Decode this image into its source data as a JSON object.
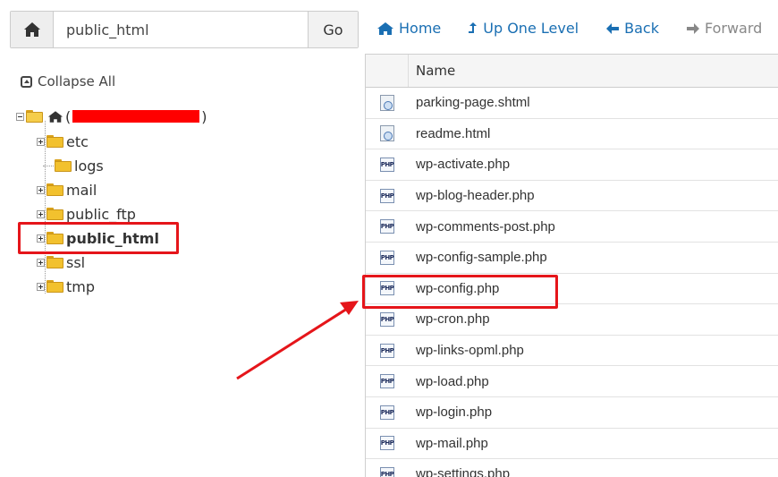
{
  "pathbar": {
    "path_value": "public_html",
    "go_label": "Go",
    "home_icon": "home-icon"
  },
  "nav": {
    "home": "Home",
    "up": "Up One Level",
    "back": "Back",
    "forward": "Forward"
  },
  "tree": {
    "collapse_label": "Collapse All",
    "root_open_paren": "(",
    "root_close_paren": ")",
    "items": [
      {
        "label": "etc",
        "expandable": true
      },
      {
        "label": "logs",
        "expandable": false
      },
      {
        "label": "mail",
        "expandable": true
      },
      {
        "label": "public_ftp",
        "expandable": true
      },
      {
        "label": "public_html",
        "expandable": true,
        "selected": true
      },
      {
        "label": "ssl",
        "expandable": true
      },
      {
        "label": "tmp",
        "expandable": true
      }
    ]
  },
  "files": {
    "column_name": "Name",
    "rows": [
      {
        "name": "parking-page.shtml",
        "type": "html"
      },
      {
        "name": "readme.html",
        "type": "html"
      },
      {
        "name": "wp-activate.php",
        "type": "php"
      },
      {
        "name": "wp-blog-header.php",
        "type": "php"
      },
      {
        "name": "wp-comments-post.php",
        "type": "php"
      },
      {
        "name": "wp-config-sample.php",
        "type": "php"
      },
      {
        "name": "wp-config.php",
        "type": "php",
        "highlighted": true
      },
      {
        "name": "wp-cron.php",
        "type": "php"
      },
      {
        "name": "wp-links-opml.php",
        "type": "php"
      },
      {
        "name": "wp-load.php",
        "type": "php"
      },
      {
        "name": "wp-login.php",
        "type": "php"
      },
      {
        "name": "wp-mail.php",
        "type": "php"
      },
      {
        "name": "wp-settings.php",
        "type": "php"
      }
    ],
    "php_icon_text": "PHP"
  },
  "colors": {
    "accent": "#1a6fb3",
    "highlight": "#e5151a",
    "redaction": "#ff0000"
  }
}
